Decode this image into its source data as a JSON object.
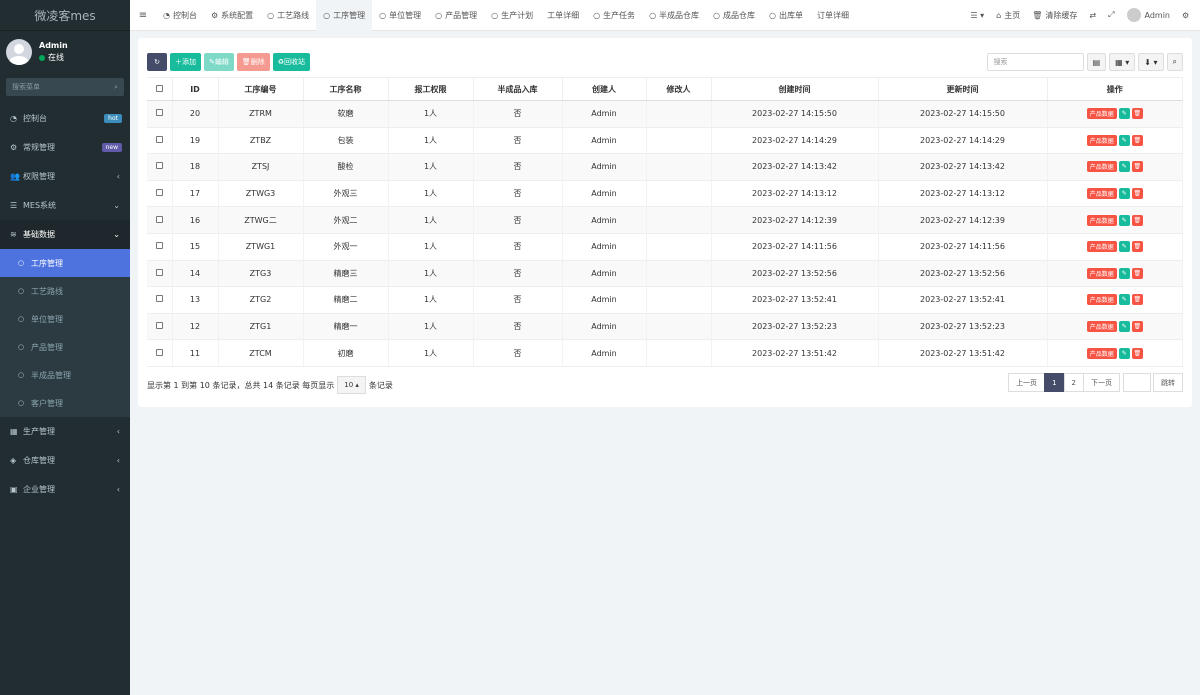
{
  "brand": "微凌客mes",
  "user": {
    "name": "Admin",
    "status": "在线"
  },
  "sidebar_search_placeholder": "搜索菜单",
  "menu": [
    {
      "label": "控制台",
      "icon": "dashboard-icon",
      "glyph": "◔",
      "badge": "hot",
      "badge_color": "#3c8dbc"
    },
    {
      "label": "常规管理",
      "icon": "cogs-icon",
      "glyph": "⚙",
      "badge": "new",
      "badge_color": "#605ca8"
    },
    {
      "label": "权限管理",
      "icon": "users-icon",
      "glyph": "👥",
      "arrow": "‹"
    },
    {
      "label": "MES系统",
      "icon": "list-icon",
      "glyph": "☰",
      "arrow": "⌄"
    },
    {
      "label": "基础数据",
      "icon": "database-icon",
      "glyph": "≋",
      "arrow": "⌄"
    }
  ],
  "submenu": [
    "工序管理",
    "工艺路线",
    "单位管理",
    "产品管理",
    "半成品管理",
    "客户管理"
  ],
  "menu_after": [
    {
      "label": "生产管理",
      "icon": "calendar-icon",
      "glyph": "▦"
    },
    {
      "label": "仓库管理",
      "icon": "cube-icon",
      "glyph": "◈"
    },
    {
      "label": "企业管理",
      "icon": "building-icon",
      "glyph": "▣"
    }
  ],
  "tabs": [
    {
      "label": "控制台",
      "glyph": "◔"
    },
    {
      "label": "系统配置",
      "glyph": "⚙"
    },
    {
      "label": "工艺路线",
      "glyph": "○"
    },
    {
      "label": "工序管理",
      "glyph": "○",
      "active": true
    },
    {
      "label": "单位管理",
      "glyph": "○"
    },
    {
      "label": "产品管理",
      "glyph": "○"
    },
    {
      "label": "生产计划",
      "glyph": "○"
    },
    {
      "label": "工单详细",
      "glyph": ""
    },
    {
      "label": "生产任务",
      "glyph": "○"
    },
    {
      "label": "半成品仓库",
      "glyph": "○"
    },
    {
      "label": "成品仓库",
      "glyph": "○"
    },
    {
      "label": "出库单",
      "glyph": "○"
    },
    {
      "label": "订单详细",
      "glyph": ""
    }
  ],
  "topright": {
    "home": "主页",
    "clear_cache": "清除缓存",
    "user": "Admin"
  },
  "toolbar": {
    "add": "添加",
    "edit": "编辑",
    "delete": "删除",
    "recycle": "回收站"
  },
  "search_placeholder": "搜索",
  "table": {
    "headers": [
      "ID",
      "工序编号",
      "工序名称",
      "报工权限",
      "半成品入库",
      "创建人",
      "修改人",
      "创建时间",
      "更新时间",
      "操作"
    ],
    "product_btn": "产品数据",
    "rows": [
      {
        "id": "20",
        "code": "ZTRM",
        "name": "软磨",
        "perm": "1人",
        "semi": "否",
        "creator": "Admin",
        "modifier": "",
        "created": "2023-02-27 14:15:50",
        "updated": "2023-02-27 14:15:50"
      },
      {
        "id": "19",
        "code": "ZTBZ",
        "name": "包装",
        "perm": "1人",
        "semi": "否",
        "creator": "Admin",
        "modifier": "",
        "created": "2023-02-27 14:14:29",
        "updated": "2023-02-27 14:14:29"
      },
      {
        "id": "18",
        "code": "ZTSJ",
        "name": "酸检",
        "perm": "1人",
        "semi": "否",
        "creator": "Admin",
        "modifier": "",
        "created": "2023-02-27 14:13:42",
        "updated": "2023-02-27 14:13:42"
      },
      {
        "id": "17",
        "code": "ZTWG3",
        "name": "外观三",
        "perm": "1人",
        "semi": "否",
        "creator": "Admin",
        "modifier": "",
        "created": "2023-02-27 14:13:12",
        "updated": "2023-02-27 14:13:12"
      },
      {
        "id": "16",
        "code": "ZTWG二",
        "name": "外观二",
        "perm": "1人",
        "semi": "否",
        "creator": "Admin",
        "modifier": "",
        "created": "2023-02-27 14:12:39",
        "updated": "2023-02-27 14:12:39"
      },
      {
        "id": "15",
        "code": "ZTWG1",
        "name": "外观一",
        "perm": "1人",
        "semi": "否",
        "creator": "Admin",
        "modifier": "",
        "created": "2023-02-27 14:11:56",
        "updated": "2023-02-27 14:11:56"
      },
      {
        "id": "14",
        "code": "ZTG3",
        "name": "精磨三",
        "perm": "1人",
        "semi": "否",
        "creator": "Admin",
        "modifier": "",
        "created": "2023-02-27 13:52:56",
        "updated": "2023-02-27 13:52:56"
      },
      {
        "id": "13",
        "code": "ZTG2",
        "name": "精磨二",
        "perm": "1人",
        "semi": "否",
        "creator": "Admin",
        "modifier": "",
        "created": "2023-02-27 13:52:41",
        "updated": "2023-02-27 13:52:41"
      },
      {
        "id": "12",
        "code": "ZTG1",
        "name": "精磨一",
        "perm": "1人",
        "semi": "否",
        "creator": "Admin",
        "modifier": "",
        "created": "2023-02-27 13:52:23",
        "updated": "2023-02-27 13:52:23"
      },
      {
        "id": "11",
        "code": "ZTCM",
        "name": "初磨",
        "perm": "1人",
        "semi": "否",
        "creator": "Admin",
        "modifier": "",
        "created": "2023-02-27 13:51:42",
        "updated": "2023-02-27 13:51:42"
      }
    ]
  },
  "footer": {
    "info": "显示第 1 到第 10 条记录，总共 14 条记录 每页显示",
    "page_size": "10",
    "suffix": "条记录"
  },
  "pager": {
    "prev": "上一页",
    "pages": [
      "1",
      "2"
    ],
    "next": "下一页",
    "go": "跳转"
  }
}
